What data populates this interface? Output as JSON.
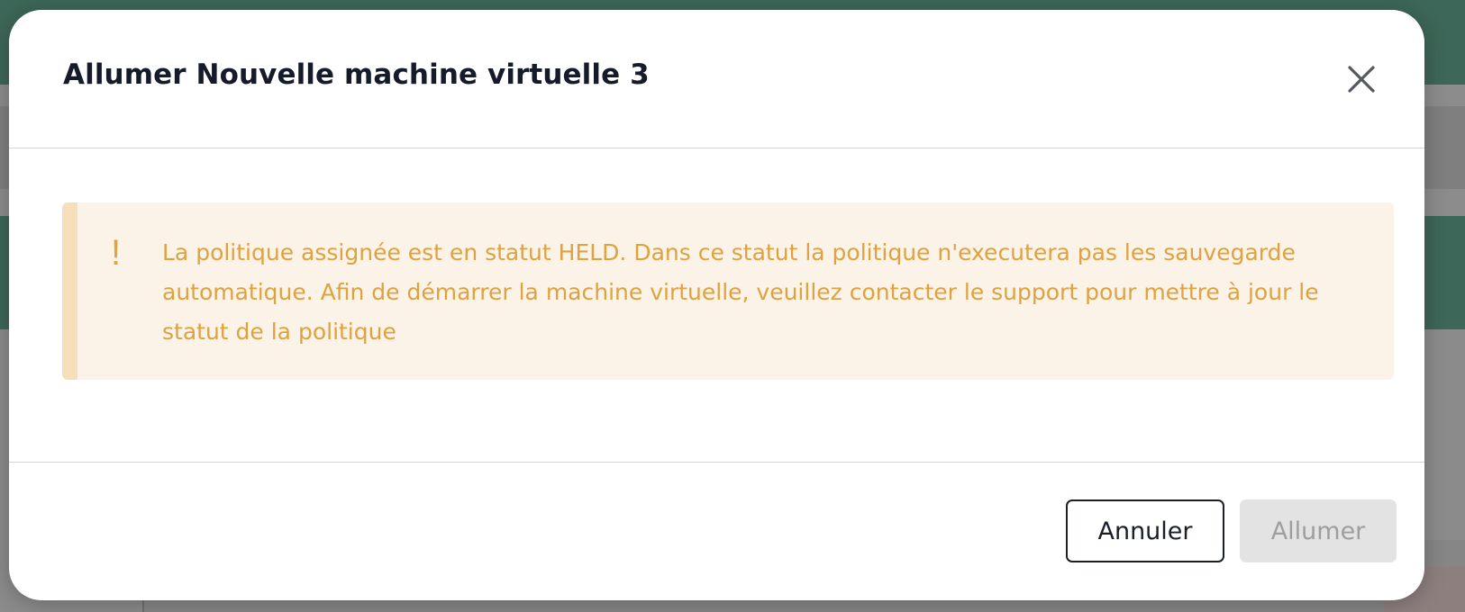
{
  "modal": {
    "title": "Allumer Nouvelle machine virtuelle 3",
    "alert": {
      "icon": "!",
      "message": "La politique assignée est en statut HELD. Dans ce statut la politique n'executera pas les sauvegarde automatique. Afin de démarrer la machine virtuelle, veuillez contacter le support pour mettre à jour le statut de la politique"
    },
    "footer": {
      "cancel_label": "Annuler",
      "confirm_label": "Allumer"
    }
  },
  "colors": {
    "title": "#161b2b",
    "warning_text": "#e0a13f",
    "warning_bg": "#fbf3e8",
    "warning_bar": "#f6dfbb",
    "disabled_bg": "#e3e3e3",
    "disabled_text": "#9e9e9e",
    "backdrop_green": "#3d6758"
  }
}
